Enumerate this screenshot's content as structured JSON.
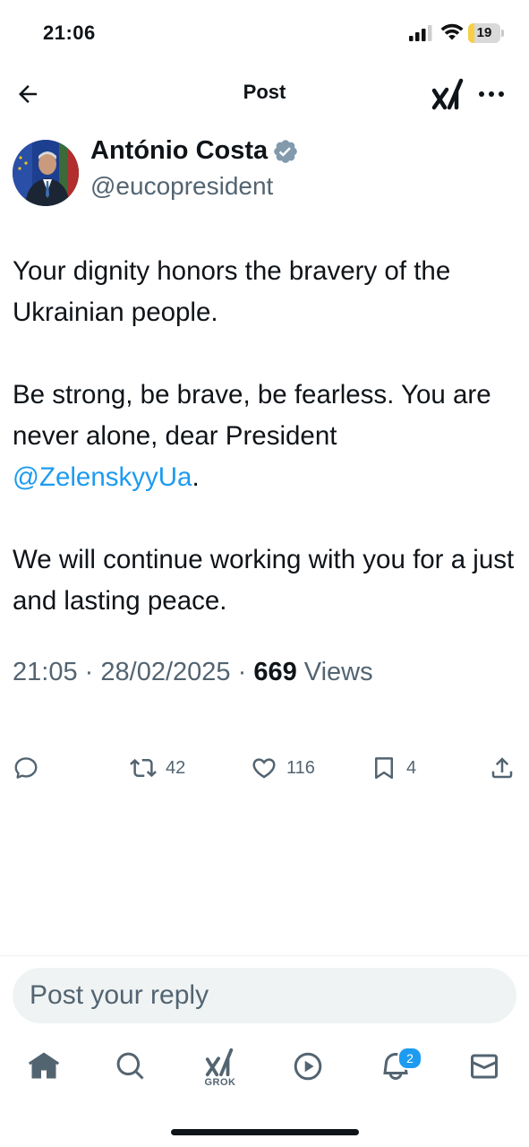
{
  "status_bar": {
    "time": "21:06",
    "battery_level": "19",
    "battery_fraction": 0.19,
    "battery_color": "#f7ce45",
    "icons": [
      "signal-icon",
      "wifi-icon",
      "battery-icon"
    ]
  },
  "header": {
    "title": "Post",
    "icons": [
      "back-arrow-icon",
      "grok-icon",
      "more-icon"
    ]
  },
  "author": {
    "name": "António Costa",
    "handle": "@eucopresident",
    "verified": true,
    "verified_color": "#829aab"
  },
  "post": {
    "paragraph1": "Your dignity honors the bravery of the Ukrainian people.",
    "paragraph2_text": "Be strong, be brave, be fearless. You are never alone, dear President ",
    "paragraph2_mention": "@ZelenskyyUa",
    "paragraph2_end": ".",
    "paragraph3": "We will continue working with you for a just and lasting peace.",
    "time": "21:05",
    "separator": "·",
    "date": "28/02/2025",
    "views_count": "669",
    "views_label": "Views"
  },
  "actions": {
    "reply_icon": "reply-icon",
    "retweets": "42",
    "likes": "116",
    "bookmarks": "4",
    "share_icon": "share-icon"
  },
  "reply": {
    "placeholder": "Post your reply"
  },
  "bottom_nav": {
    "items": [
      "home-icon",
      "search-icon",
      "grok-icon",
      "video-icon",
      "notifications-icon",
      "messages-icon"
    ],
    "grok_label": "GROK",
    "notification_badge": "2"
  },
  "colors": {
    "link": "#1d9bf0",
    "secondary_text": "#536471",
    "primary_text": "#0f1419"
  }
}
